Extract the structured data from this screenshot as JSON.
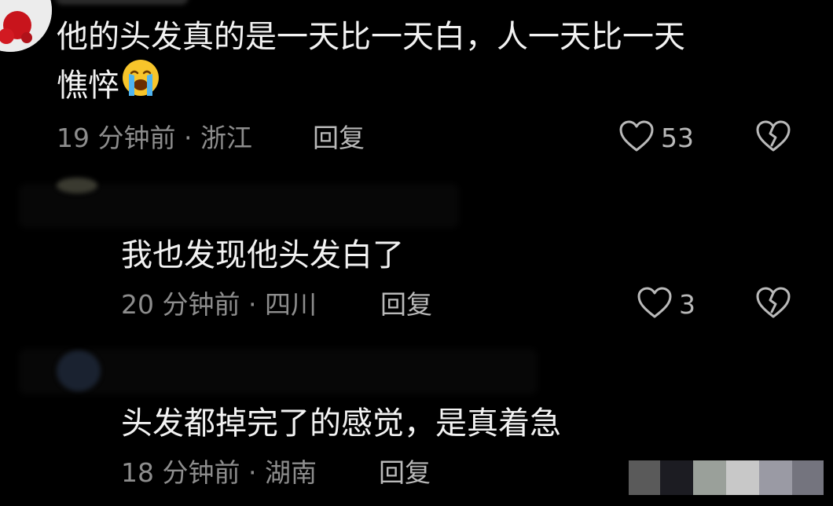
{
  "colors": {
    "background": "#000000",
    "text_primary": "#f2f2f2",
    "text_meta": "#8d8d8d",
    "text_reply": "#b9b9b9",
    "icon": "#b9b9b9"
  },
  "comments": [
    {
      "text_line1": "他的头发真的是一天比一天白，人一天比一天",
      "text_line2": "憔悴",
      "emoji": "loudly-crying-face",
      "meta": "19 分钟前 · 浙江",
      "reply_label": "回复",
      "likes": "53",
      "like_icon": "heart-outline-icon",
      "dislike_icon": "broken-heart-icon"
    },
    {
      "text": "我也发现他头发白了",
      "meta": "20 分钟前 · 四川",
      "reply_label": "回复",
      "likes": "3",
      "like_icon": "heart-outline-icon",
      "dislike_icon": "broken-heart-icon"
    },
    {
      "text": "头发都掉完了的感觉，是真着急",
      "meta": "18 分钟前 · 湖南",
      "reply_label": "回复"
    }
  ]
}
